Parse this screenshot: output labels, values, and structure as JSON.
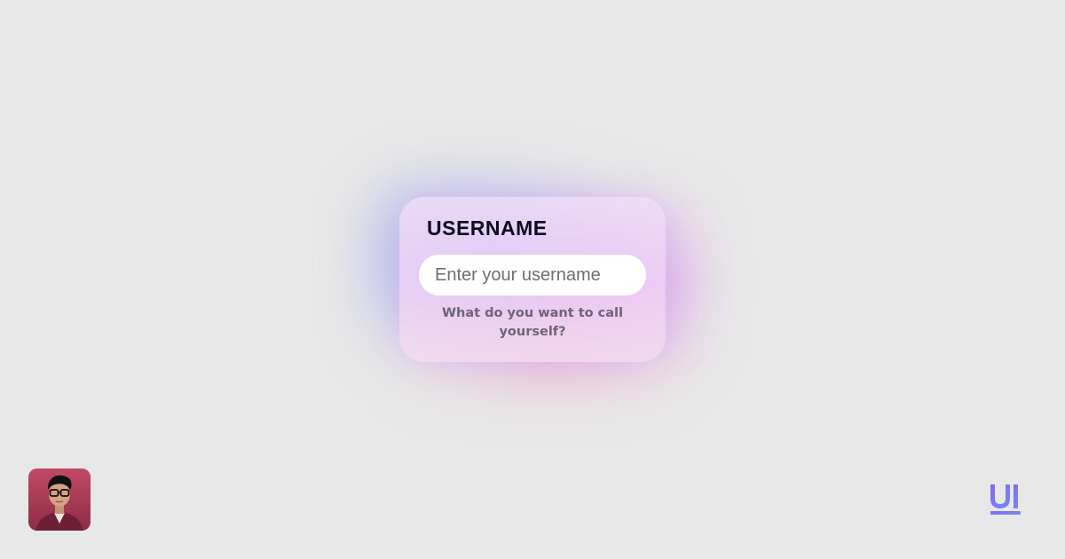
{
  "card": {
    "title": "USERNAME",
    "input_placeholder": "Enter your username",
    "input_value": "",
    "hint": "What do you want to call yourself?"
  },
  "footer": {
    "avatar_icon": "profile-photo",
    "logo_icon": "ui-logo",
    "logo_text": "UI"
  },
  "colors": {
    "background": "#e8e8e8",
    "glow_blue": "#96a0f0",
    "glow_violet": "#dc8cf0",
    "logo_gradient_start": "#8a63f0",
    "logo_gradient_end": "#6f8ef5",
    "avatar_background": "#a93a55"
  }
}
